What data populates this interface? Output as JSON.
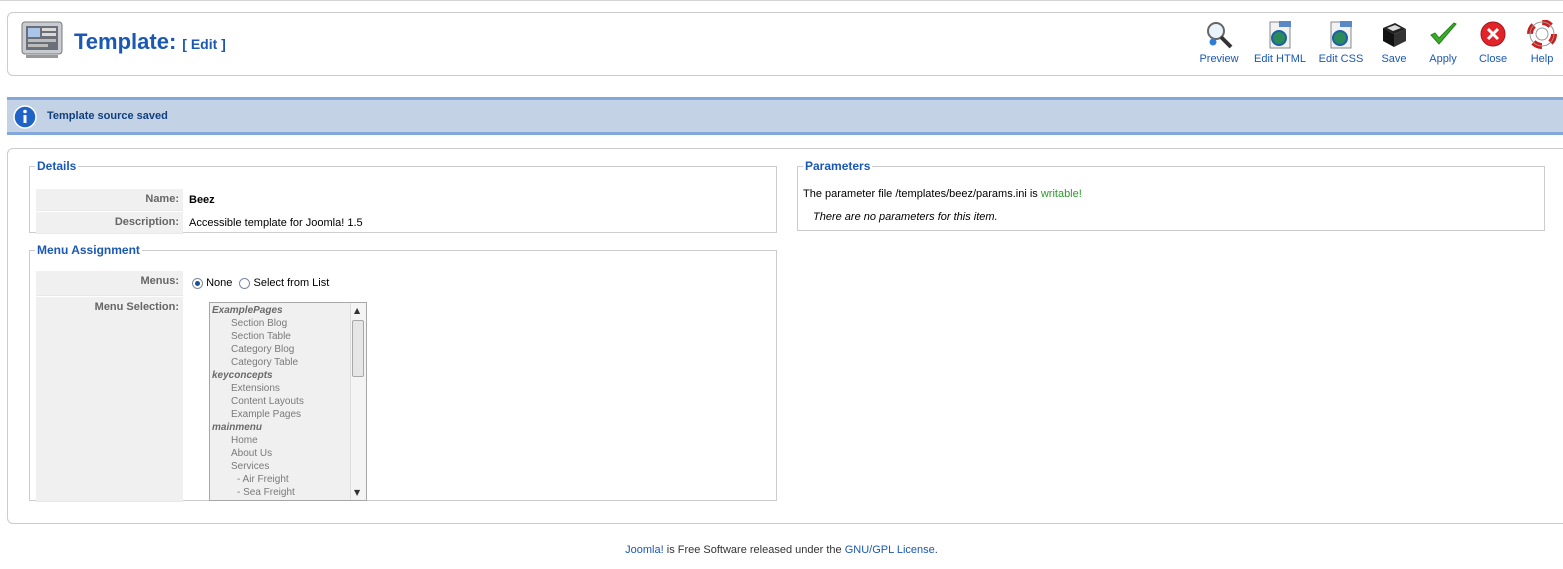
{
  "header": {
    "title": "Template:",
    "subtitle": "[ Edit ]"
  },
  "toolbar": {
    "buttons": [
      {
        "label": "Preview",
        "icon": "magnifier-icon"
      },
      {
        "label": "Edit HTML",
        "icon": "html-file-icon"
      },
      {
        "label": "Edit CSS",
        "icon": "css-file-icon"
      },
      {
        "label": "Save",
        "icon": "floppy-disk-icon"
      },
      {
        "label": "Apply",
        "icon": "checkmark-icon"
      },
      {
        "label": "Close",
        "icon": "close-circle-icon"
      },
      {
        "label": "Help",
        "icon": "lifebuoy-icon"
      }
    ]
  },
  "message": {
    "text": "Template source saved",
    "icon": "info-icon"
  },
  "details": {
    "legend": "Details",
    "name_label": "Name:",
    "name_value": "Beez",
    "description_label": "Description:",
    "description_value": "Accessible template for Joomla! 1.5"
  },
  "menu_assignment": {
    "legend": "Menu Assignment",
    "menus_label": "Menus:",
    "radio_none": "None",
    "radio_select": "Select from List",
    "selected": "None",
    "selection_label": "Menu Selection:",
    "options": [
      {
        "text": "ExamplePages",
        "kind": "group"
      },
      {
        "text": "Section Blog",
        "kind": "l1"
      },
      {
        "text": "Section Table",
        "kind": "l1"
      },
      {
        "text": "Category Blog",
        "kind": "l1"
      },
      {
        "text": "Category Table",
        "kind": "l1"
      },
      {
        "text": "keyconcepts",
        "kind": "group"
      },
      {
        "text": "Extensions",
        "kind": "l1"
      },
      {
        "text": "Content Layouts",
        "kind": "l1"
      },
      {
        "text": "Example Pages",
        "kind": "l1"
      },
      {
        "text": "mainmenu",
        "kind": "group"
      },
      {
        "text": "Home",
        "kind": "l1"
      },
      {
        "text": "About Us",
        "kind": "l1"
      },
      {
        "text": "Services",
        "kind": "l1"
      },
      {
        "text": "- Air Freight",
        "kind": "l2"
      },
      {
        "text": "- Sea Freight",
        "kind": "l2"
      }
    ]
  },
  "parameters": {
    "legend": "Parameters",
    "file_text": "The parameter file /templates/beez/params.ini is",
    "writable": "writable!",
    "none_text": "There are no parameters for this item."
  },
  "footer": {
    "joomla_link": "Joomla!",
    "text": "is Free Software released under the",
    "license_link": "GNU/GPL License",
    "end": "."
  },
  "colors": {
    "link_blue": "#1a58b4",
    "message_bg": "#c3d2e5",
    "message_border": "#84a7db",
    "writable_green": "#2a9a2a"
  }
}
